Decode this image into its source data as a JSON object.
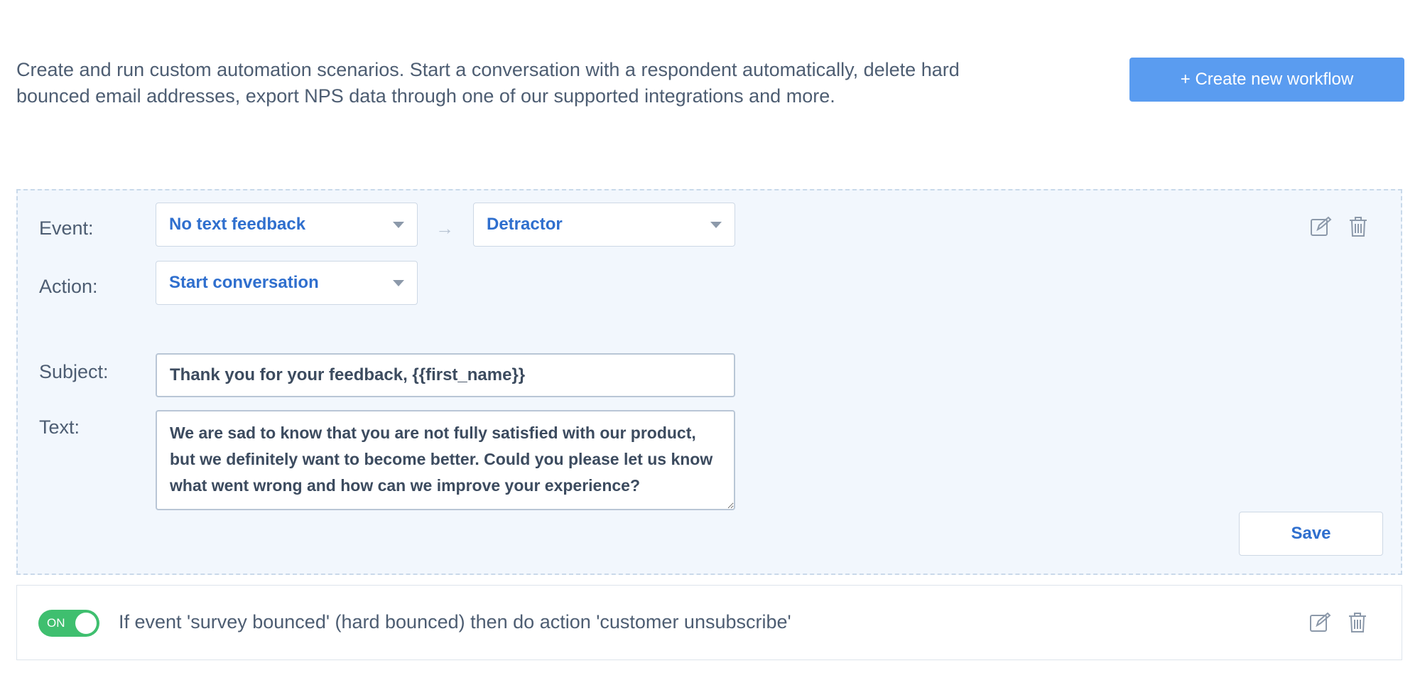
{
  "intro": {
    "text": "Create and run custom automation scenarios. Start a conversation with a respondent automatically, delete hard bounced email addresses, export NPS data through one of our supported integrations and more."
  },
  "header": {
    "create_button_label": "+ Create new workflow"
  },
  "workflow_editor": {
    "event_label": "Event:",
    "event_value": "No text feedback",
    "arrow": "→",
    "segment_value": "Detractor",
    "action_label": "Action:",
    "action_value": "Start conversation",
    "subject_label": "Subject:",
    "subject_value": "Thank you for your feedback, {{first_name}}",
    "text_label": "Text:",
    "text_value": "We are sad to know that you are not fully satisfied with our product, but we definitely want to become better. Could you please let us know what went wrong and how can we improve your experience?",
    "save_label": "Save",
    "edit_icon": "edit-icon",
    "delete_icon": "trash-icon"
  },
  "rule": {
    "toggle_label": "ON",
    "toggle_state": "on",
    "text": "If event 'survey bounced' (hard bounced) then do action 'customer unsubscribe'",
    "edit_icon": "edit-icon",
    "delete_icon": "trash-icon"
  },
  "colors": {
    "accent": "#5a9cf0",
    "link": "#2f6fce",
    "toggle_on": "#3fbf6f",
    "panel_bg": "#f2f7fd"
  }
}
